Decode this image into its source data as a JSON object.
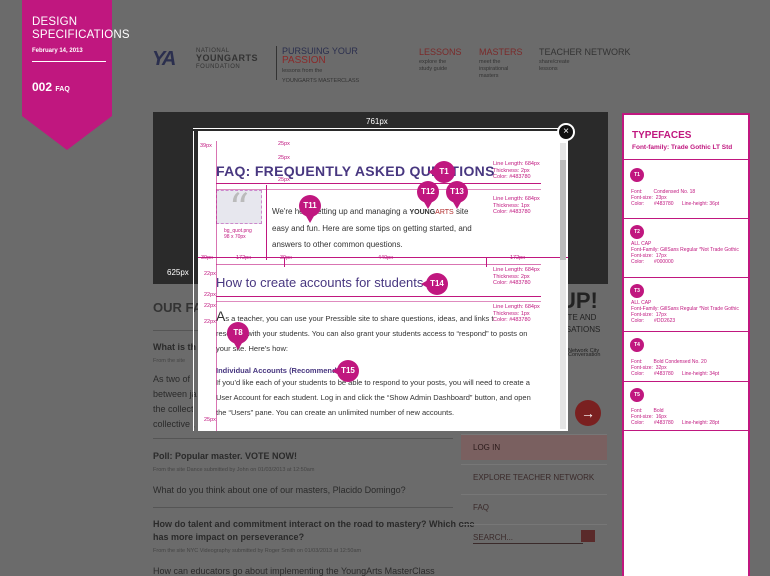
{
  "ribbon": {
    "title": "DESIGN SPECIFICATIONS",
    "date": "February 14, 2013",
    "code": "002",
    "code_label": "FAQ",
    "color": "#c0177f"
  },
  "header": {
    "logo_mark": "YA",
    "logo_org_top": "NATIONAL",
    "logo_org_mid": "YOUNGARTS",
    "logo_org_bot": "FOUNDATION",
    "tagline_1": "PURSUING YOUR",
    "tagline_2": "PASSION",
    "tagline_3": "lessons from the",
    "tagline_4": "YOUNGARTS MASTERCLASS",
    "nav": [
      {
        "label": "LESSONS",
        "sub1": "explore the",
        "sub2": "study guide"
      },
      {
        "label": "MASTERS",
        "sub1": "meet the",
        "sub2": "inspirational",
        "sub3": "masters"
      },
      {
        "label": "TEACHER NETWORK",
        "sub1": "share/create",
        "sub2": "lessons"
      }
    ]
  },
  "hero": {
    "width_label": "625px"
  },
  "background": {
    "section_title": "OUR FA",
    "q1": "What is th",
    "q1_meta": "From the site",
    "q1_text_1": "As two of",
    "q1_text_2": "between ja",
    "q1_text_3": "the collect",
    "q1_text_4": "collective ,",
    "poll_title": "Poll: Popular master. VOTE NOW!",
    "poll_meta": "From the site Dance submitted by John on 01/03/2013 at 12:50am",
    "poll_text": "What do you think about one of our masters, Placido Domingo?",
    "q3_title_1": "How do talent and commitment interact on the road to mastery? Which one",
    "q3_title_2": "has more impact on perseverance?",
    "q3_meta": "From the site NYC Videography submitted by Roger Smith on 01/03/2013 at 12:50am",
    "q3_text": "How can educators go about implementing the YoungArts MasterClass",
    "side_up": "UP!",
    "side_sub_1": "SITE AND",
    "side_sub_2": "RSATIONS",
    "side_note_1": "Network City",
    "side_note_2": "Conversation",
    "menu": [
      "LOG IN",
      "EXPLORE TEACHER NETWORK",
      "FAQ",
      "SEARCH..."
    ]
  },
  "modal": {
    "width_label": "761px",
    "title": "FAQ: FREQUENTLY ASKED QUESTIONS",
    "quote_note_1": "bg_quot.png",
    "quote_note_2": "98 x 70px",
    "intro_1": "We're here setting up and managing a",
    "intro_ya_1": "YOUNG",
    "intro_ya_2": "ARTS",
    "intro_2": "site",
    "intro_3": "easy and fun. Here are some tips on getting started, and",
    "intro_4": "answers to other common questions.",
    "h2": "How to create accounts for students",
    "para_dropcap": "A",
    "para_1": "s a teacher, you can use your Pressible site to share questions, ideas, and links t",
    "para_2": "resource with your students. You can also grant your students access to “respond” to posts on",
    "para_3": "your site. Here’s how:",
    "h3": "Individual Accounts (Recommended)",
    "para2_1": "If you’d like each of your students to be able to respond to your posts, you will need to create a",
    "para2_2": "User Account for each student. Log in and click the “Show Admin Dashboard” button, and open",
    "para2_3": "the “Users” pane. You can create an unlimited number of new accounts.",
    "close": "×"
  },
  "annotations": {
    "pins": [
      "T1",
      "T12",
      "T13",
      "T11",
      "T14",
      "T8",
      "T15"
    ],
    "dims": [
      "39px",
      "25px",
      "25px",
      "25px",
      "172px",
      "440px",
      "172px",
      "39px",
      "22px",
      "22px",
      "22px",
      "22px",
      "39px",
      "25px",
      "39px",
      "39px",
      "39px",
      "39px",
      "39px"
    ],
    "spec_t1": [
      "Line Length: 684px",
      "Thickness: 2px",
      "Color: #483780"
    ],
    "spec_mid": [
      "Line Length: 684px",
      "Thickness: 1px",
      "Color: #483780"
    ],
    "spec_bot1": [
      "Line Length: 684px",
      "Thickness: 2px",
      "Color: #483780"
    ],
    "spec_bot2": [
      "Line Length: 684px",
      "Thickness: 1px",
      "Color: #483780"
    ]
  },
  "typefaces": {
    "title": "TYPEFACES",
    "family": "Font-family: Trade Gothic LT Std",
    "entries": [
      {
        "id": "T1",
        "spec": "Font:        Condensed No. 18\nFont-size:  23px\nColor:       #483780      Line-height: 36pt"
      },
      {
        "id": "T2",
        "spec": "ALL CAP\nFont-Family: GillSans Regular *Not Trade Gothic\nFont-size:  17px\nColor:       #000000"
      },
      {
        "id": "T3",
        "spec": "ALL CAP\nFont-Family: GillSans Regular *Not Trade Gothic\nFont-size:  17px\nColor:       #DD2623"
      },
      {
        "id": "T4",
        "spec": "Font:        Bold Condensed No. 20\nFont-size:  32px\nColor:       #483780      Line-height: 34pt"
      },
      {
        "id": "T5",
        "spec": "Font:        Bold\nFont-size:  16px\nColor:       #483780      Line-height: 28pt"
      }
    ]
  }
}
